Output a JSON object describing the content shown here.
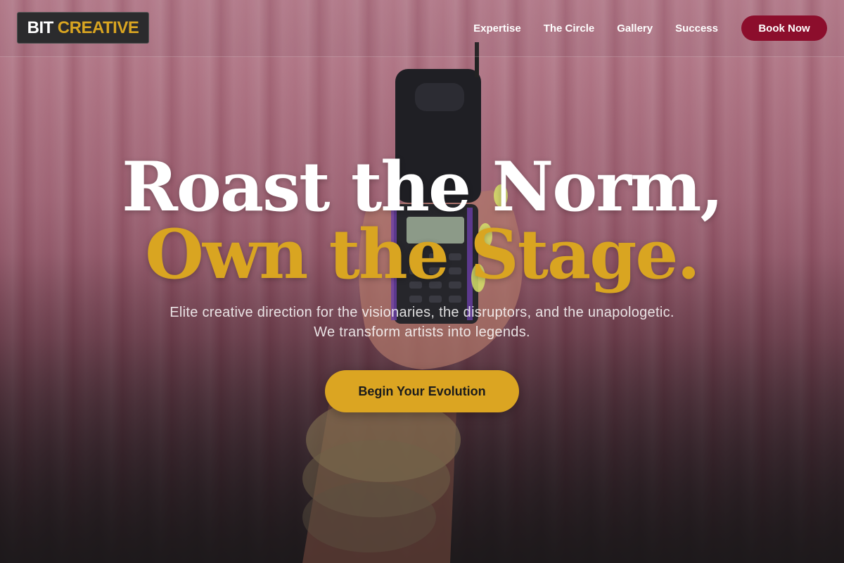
{
  "brand": {
    "word1": "BIT",
    "word2": "CREATIVE"
  },
  "nav": {
    "links": [
      "Expertise",
      "The Circle",
      "Gallery",
      "Success"
    ],
    "book_label": "Book Now"
  },
  "hero": {
    "headline_line1": "Roast the Norm,",
    "headline_line2": "Own the Stage.",
    "subtitle_line1": "Elite creative direction for the visionaries, the disruptors, and the unapologetic.",
    "subtitle_line2": "We transform artists into legends.",
    "cta_label": "Begin Your Evolution"
  },
  "colors": {
    "accent_gold": "#d9a521",
    "accent_burgundy": "#8c0e2c",
    "logo_bg": "#2b2b2d"
  },
  "icons": {
    "hero_image": "hand-holding-flip-phone"
  }
}
